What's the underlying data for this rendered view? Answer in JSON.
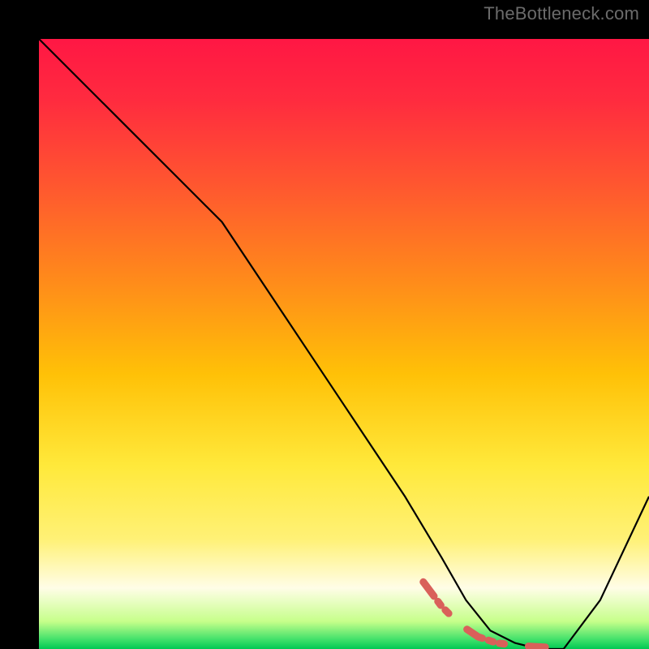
{
  "watermark": "TheBottleneck.com",
  "chart_data": {
    "type": "line",
    "title": "",
    "xlabel": "",
    "ylabel": "",
    "xlim": [
      0,
      100
    ],
    "ylim": [
      0,
      100
    ],
    "grid": false,
    "legend": false,
    "gradient_stops": [
      {
        "offset": 0.0,
        "color": "#ff1744"
      },
      {
        "offset": 0.1,
        "color": "#ff2b3f"
      },
      {
        "offset": 0.25,
        "color": "#ff5a2e"
      },
      {
        "offset": 0.4,
        "color": "#ff8c1a"
      },
      {
        "offset": 0.55,
        "color": "#ffc107"
      },
      {
        "offset": 0.7,
        "color": "#ffe93b"
      },
      {
        "offset": 0.82,
        "color": "#fff176"
      },
      {
        "offset": 0.9,
        "color": "#fffde7"
      },
      {
        "offset": 0.955,
        "color": "#c6ff8a"
      },
      {
        "offset": 0.985,
        "color": "#3fe06a"
      },
      {
        "offset": 1.0,
        "color": "#00c853"
      }
    ],
    "series": [
      {
        "name": "bottleneck-curve",
        "stroke": "#000000",
        "stroke_width": 2.2,
        "x": [
          0,
          6,
          14,
          22,
          26,
          30,
          40,
          50,
          60,
          66,
          70,
          74,
          78,
          82,
          86,
          92,
          100
        ],
        "y": [
          100,
          94,
          86,
          78,
          74,
          70,
          55,
          40,
          25,
          15,
          8,
          3,
          1,
          0,
          0,
          8,
          25
        ]
      },
      {
        "name": "recommended-region",
        "stroke": "#d9605a",
        "stroke_width": 9,
        "dash": "22 8 6 8 6 30",
        "x": [
          63,
          66,
          69,
          72,
          75,
          78,
          81,
          83
        ],
        "y": [
          11,
          7,
          4,
          2,
          1,
          0.6,
          0.4,
          0.3
        ]
      }
    ]
  }
}
